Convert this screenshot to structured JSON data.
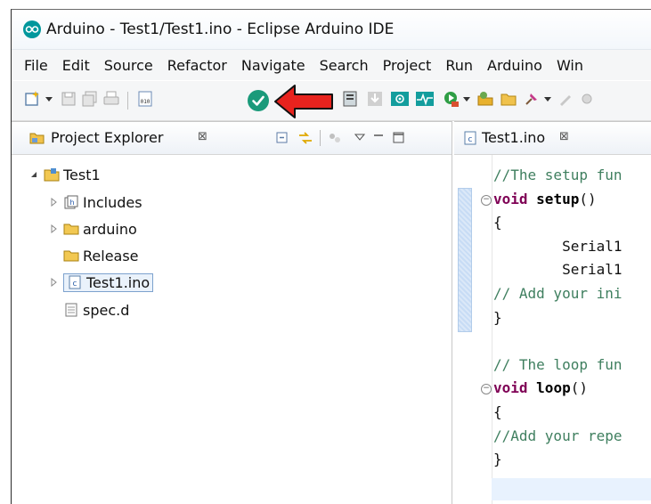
{
  "window": {
    "title": "Arduino - Test1/Test1.ino - Eclipse Arduino IDE"
  },
  "menu": [
    "File",
    "Edit",
    "Source",
    "Refactor",
    "Navigate",
    "Search",
    "Project",
    "Run",
    "Arduino",
    "Win"
  ],
  "project_explorer": {
    "tab_label": "Project Explorer",
    "close_glyph": "⊠",
    "tree": [
      {
        "label": "Test1",
        "icon": "project-folder-icon",
        "expanded": true
      },
      {
        "label": "Includes",
        "icon": "includes-icon",
        "expanded": false
      },
      {
        "label": "arduino",
        "icon": "folder-icon",
        "expanded": false
      },
      {
        "label": "Release",
        "icon": "folder-icon",
        "expanded": null
      },
      {
        "label": "Test1.ino",
        "icon": "c-file-icon",
        "expanded": false,
        "selected": true
      },
      {
        "label": "spec.d",
        "icon": "text-file-icon",
        "expanded": null
      }
    ]
  },
  "editor": {
    "tab_label": "Test1.ino",
    "close_glyph": "⊠",
    "lines": [
      {
        "parts": [
          {
            "t": "//The setup fun",
            "c": "comment"
          }
        ]
      },
      {
        "fold": true,
        "parts": [
          {
            "t": "void",
            "c": "kw"
          },
          {
            "t": " "
          },
          {
            "t": "setup",
            "c": "fn"
          },
          {
            "t": "()"
          }
        ]
      },
      {
        "parts": [
          {
            "t": "{"
          }
        ]
      },
      {
        "parts": [
          {
            "t": "        Serial1"
          }
        ]
      },
      {
        "parts": [
          {
            "t": "        Serial1"
          }
        ]
      },
      {
        "parts": [
          {
            "t": "// Add your ini",
            "c": "comment"
          }
        ]
      },
      {
        "parts": [
          {
            "t": "}"
          }
        ]
      },
      {
        "parts": [
          {
            "t": ""
          }
        ]
      },
      {
        "parts": [
          {
            "t": "// The loop fun",
            "c": "comment"
          }
        ]
      },
      {
        "fold": true,
        "parts": [
          {
            "t": "void",
            "c": "kw"
          },
          {
            "t": " "
          },
          {
            "t": "loop",
            "c": "fn"
          },
          {
            "t": "()"
          }
        ]
      },
      {
        "parts": [
          {
            "t": "{"
          }
        ]
      },
      {
        "parts": [
          {
            "t": "//Add your repe",
            "c": "comment"
          }
        ]
      },
      {
        "parts": [
          {
            "t": "}"
          }
        ]
      }
    ]
  },
  "colors": {
    "annotation_arrow": "#e8231e",
    "verify_button": "#1a9a7a",
    "comment": "#3f7f5f",
    "keyword": "#7f0055"
  }
}
